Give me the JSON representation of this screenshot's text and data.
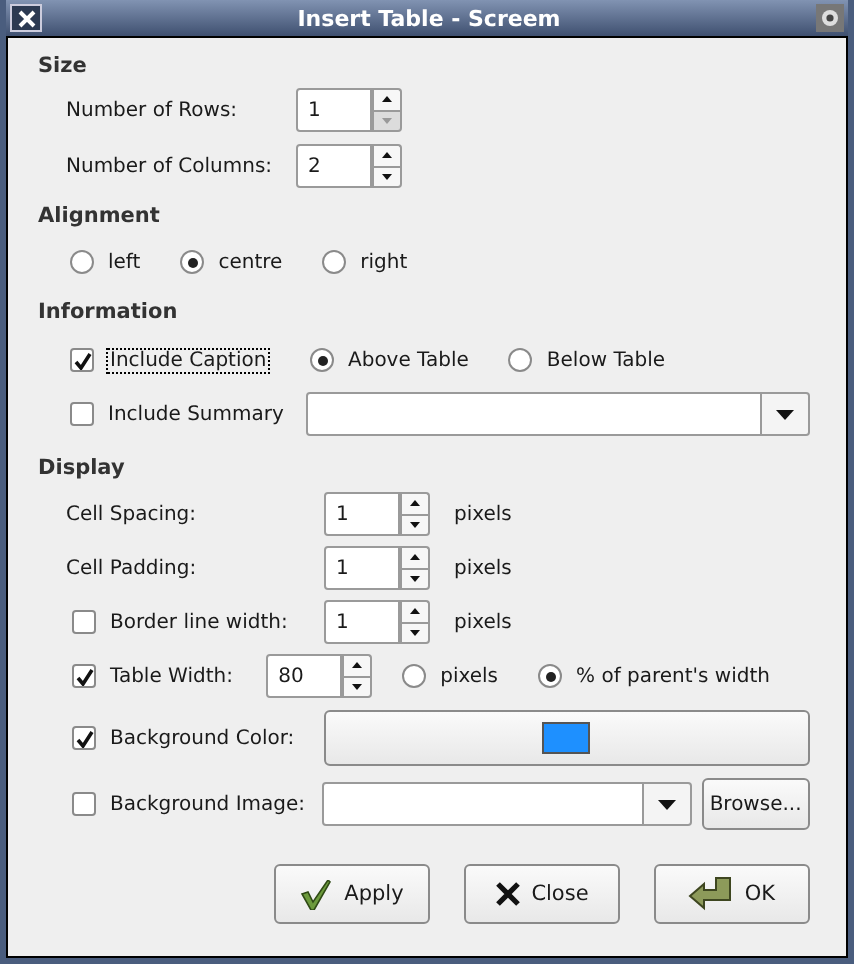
{
  "window": {
    "title": "Insert Table - Screem"
  },
  "size": {
    "heading": "Size",
    "rows": [
      {
        "label": "Number of Rows:",
        "value": "1",
        "down_disabled": true
      },
      {
        "label": "Number of Columns:",
        "value": "2",
        "down_disabled": false
      }
    ]
  },
  "alignment": {
    "heading": "Alignment",
    "options": [
      {
        "label": "left",
        "selected": false
      },
      {
        "label": "centre",
        "selected": true
      },
      {
        "label": "right",
        "selected": false
      }
    ]
  },
  "information": {
    "heading": "Information",
    "caption": {
      "label": "Include Caption",
      "checked": true,
      "focused": true
    },
    "positions": [
      {
        "label": "Above Table",
        "selected": true
      },
      {
        "label": "Below Table",
        "selected": false
      }
    ],
    "summary": {
      "label": "Include Summary",
      "checked": false
    }
  },
  "display": {
    "heading": "Display",
    "rows": [
      {
        "kind": "spin",
        "label": "Cell Spacing:",
        "value": "1",
        "unit": "pixels"
      },
      {
        "kind": "spin",
        "label": "Cell Padding:",
        "value": "1",
        "unit": "pixels"
      },
      {
        "kind": "check_spin",
        "label": "Border line width:",
        "checked": false,
        "value": "1",
        "unit": "pixels"
      },
      {
        "kind": "check_spin",
        "label": "Table Width:",
        "checked": true,
        "value": "80",
        "units": [
          {
            "label": "pixels",
            "selected": false
          },
          {
            "label": "% of parent's width",
            "selected": true
          }
        ]
      },
      {
        "kind": "check_color",
        "label": "Background Color:",
        "checked": true,
        "color": "#1e90ff"
      },
      {
        "kind": "check_image",
        "label": "Background Image:",
        "checked": false,
        "browse": "Browse..."
      }
    ]
  },
  "buttons": [
    {
      "kind": "apply",
      "label": "Apply"
    },
    {
      "kind": "close",
      "label": "Close"
    },
    {
      "kind": "ok",
      "label": "OK"
    }
  ]
}
